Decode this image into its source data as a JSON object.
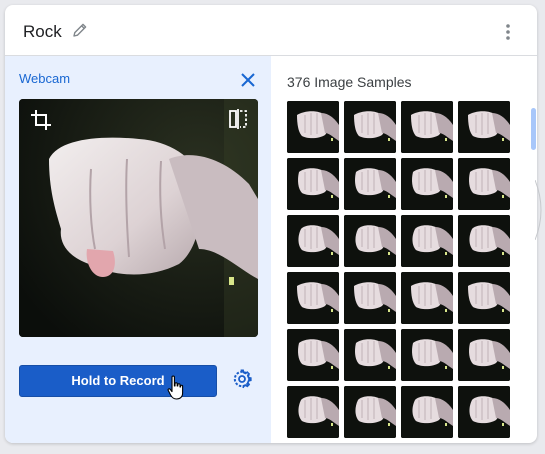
{
  "class_card": {
    "name": "Rock",
    "edit_icon": "pencil-icon",
    "menu_icon": "more-vert-icon"
  },
  "webcam_panel": {
    "label": "Webcam",
    "close_icon": "close-icon",
    "crop_icon": "crop-icon",
    "flip_icon": "flip-icon",
    "record_button": "Hold to Record",
    "settings_icon": "gear-icon"
  },
  "samples_panel": {
    "title": "376 Image Samples",
    "thumbnail_count_visible": 24
  },
  "colors": {
    "accent": "#1a5dc8",
    "panel_bg": "#e8f0fe",
    "link": "#1967d2"
  }
}
